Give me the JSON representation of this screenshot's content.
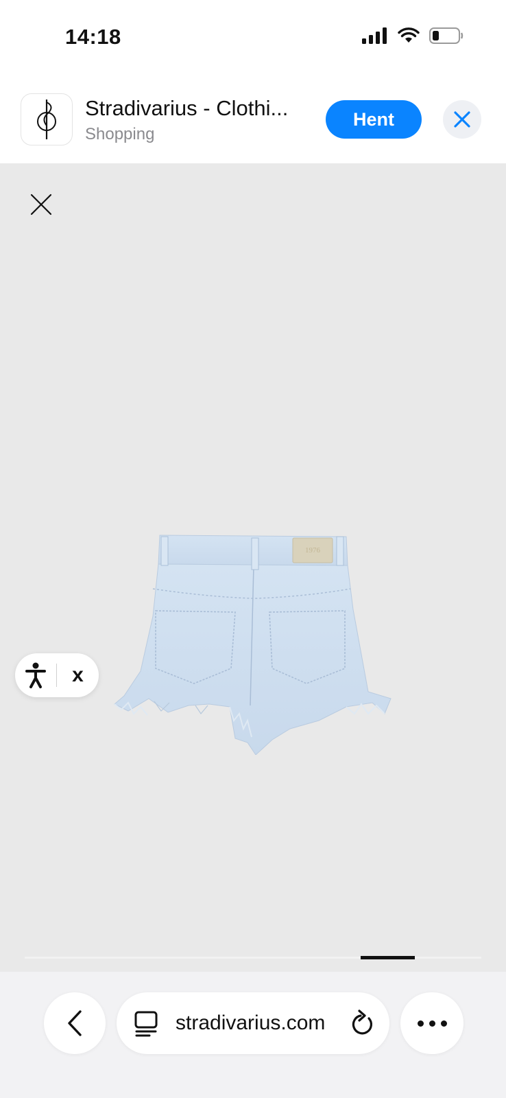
{
  "status_bar": {
    "time": "14:18",
    "icons": [
      "cellular-signal-icon",
      "wifi-icon",
      "battery-icon"
    ]
  },
  "app_banner": {
    "title": "Stradivarius - Clothi...",
    "subtitle": "Shopping",
    "get_label": "Hent",
    "icon": "stradivarius-logo-icon",
    "accent_color": "#0a84ff"
  },
  "viewer": {
    "background": "#e9e9e9",
    "image": "denim-shorts-back-view",
    "close_icon": "close-icon",
    "gallery_progress": {
      "position_start": 0.735,
      "position_end": 0.855
    }
  },
  "accessibility_widget": {
    "icon": "accessibility-person-icon",
    "close_label": "x"
  },
  "browser": {
    "url": "stradivarius.com",
    "icons": [
      "back-chevron-icon",
      "tabs-icon",
      "reload-icon",
      "more-icon"
    ]
  }
}
